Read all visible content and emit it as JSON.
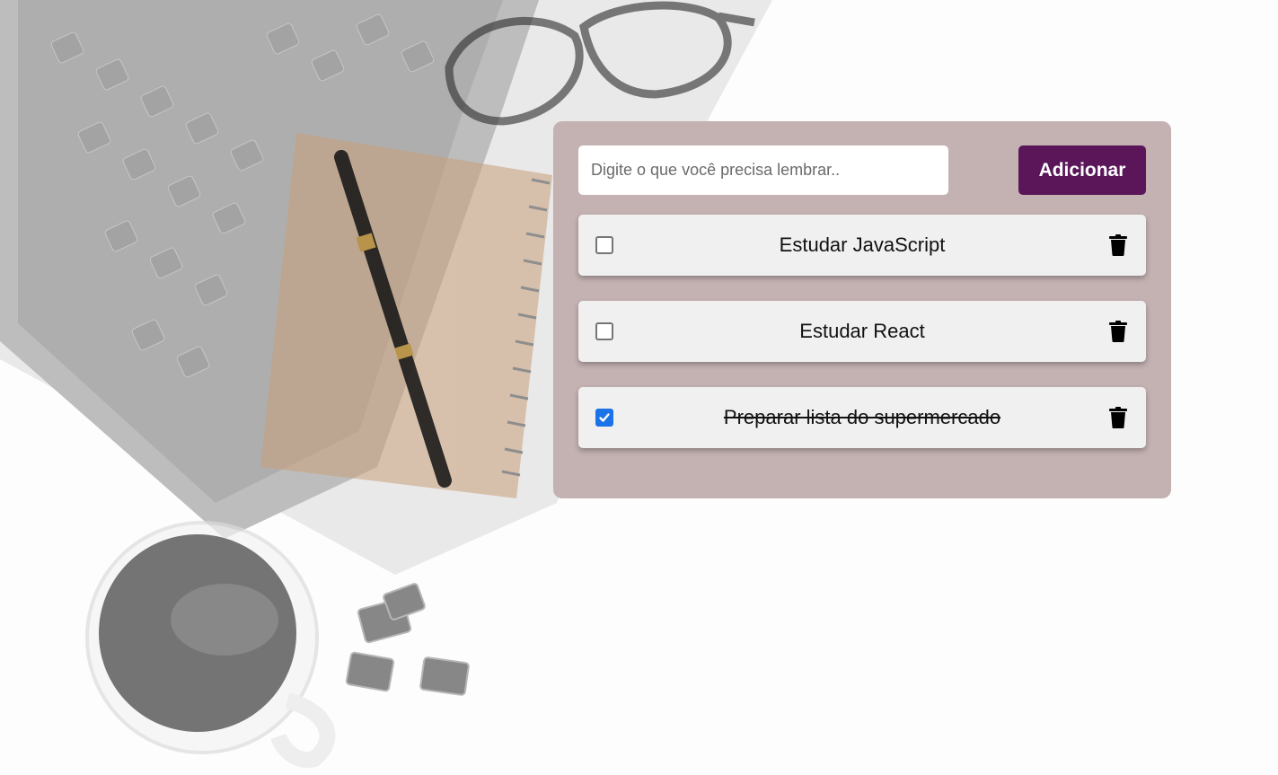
{
  "colors": {
    "panel_bg": "#c4b1b2",
    "button_bg": "#5a1659",
    "task_bg": "#f0f0f0",
    "checkbox_accent": "#1a73e8"
  },
  "form": {
    "input_value": "",
    "input_placeholder": "Digite o que você precisa lembrar..",
    "add_label": "Adicionar"
  },
  "tasks": [
    {
      "text": "Estudar JavaScript",
      "done": false,
      "delete_icon": "trash-icon"
    },
    {
      "text": "Estudar React",
      "done": false,
      "delete_icon": "trash-icon"
    },
    {
      "text": "Preparar lista do supermercado",
      "done": true,
      "delete_icon": "trash-icon"
    }
  ]
}
